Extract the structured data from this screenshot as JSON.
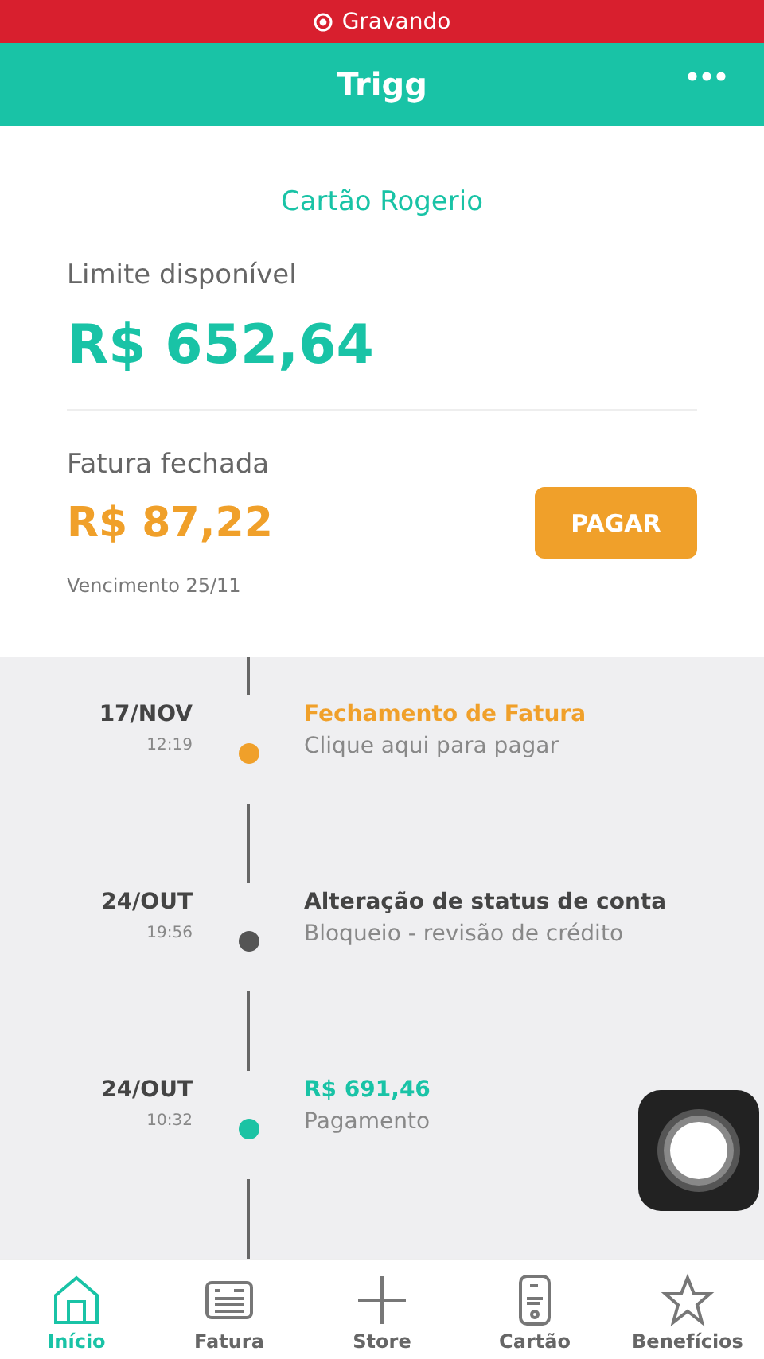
{
  "recording_bar": {
    "label": "Gravando"
  },
  "header": {
    "title": "Trigg"
  },
  "card": {
    "name": "Cartão Rogerio",
    "limit_label": "Limite disponível",
    "limit_value": "R$ 652,64",
    "invoice_label": "Fatura fechada",
    "invoice_value": "R$ 87,22",
    "pay_button": "PAGAR",
    "due": "Vencimento 25/11"
  },
  "timeline": [
    {
      "kind": "invoice",
      "date": "17/NOV",
      "time": "12:19",
      "title": "Fechamento de Fatura",
      "subtitle": "Clique aqui para pagar",
      "color": "#f0a02a"
    },
    {
      "kind": "status",
      "date": "24/OUT",
      "time": "19:56",
      "title": "Alteração de status de conta",
      "subtitle": "Bloqueio - revisão de crédito",
      "color": "#555555"
    },
    {
      "kind": "payment",
      "date": "24/OUT",
      "time": "10:32",
      "title": "R$ 691,46",
      "subtitle": "Pagamento",
      "color": "#1bc3a4"
    }
  ],
  "tab_bar": [
    {
      "kind": "home",
      "label": "Início",
      "selected": true
    },
    {
      "kind": "invoice",
      "label": "Fatura",
      "selected": false
    },
    {
      "kind": "plus",
      "label": "Store",
      "selected": false
    },
    {
      "kind": "card",
      "label": "Cartão",
      "selected": false
    },
    {
      "kind": "star",
      "label": "Benefícios",
      "selected": false
    }
  ]
}
